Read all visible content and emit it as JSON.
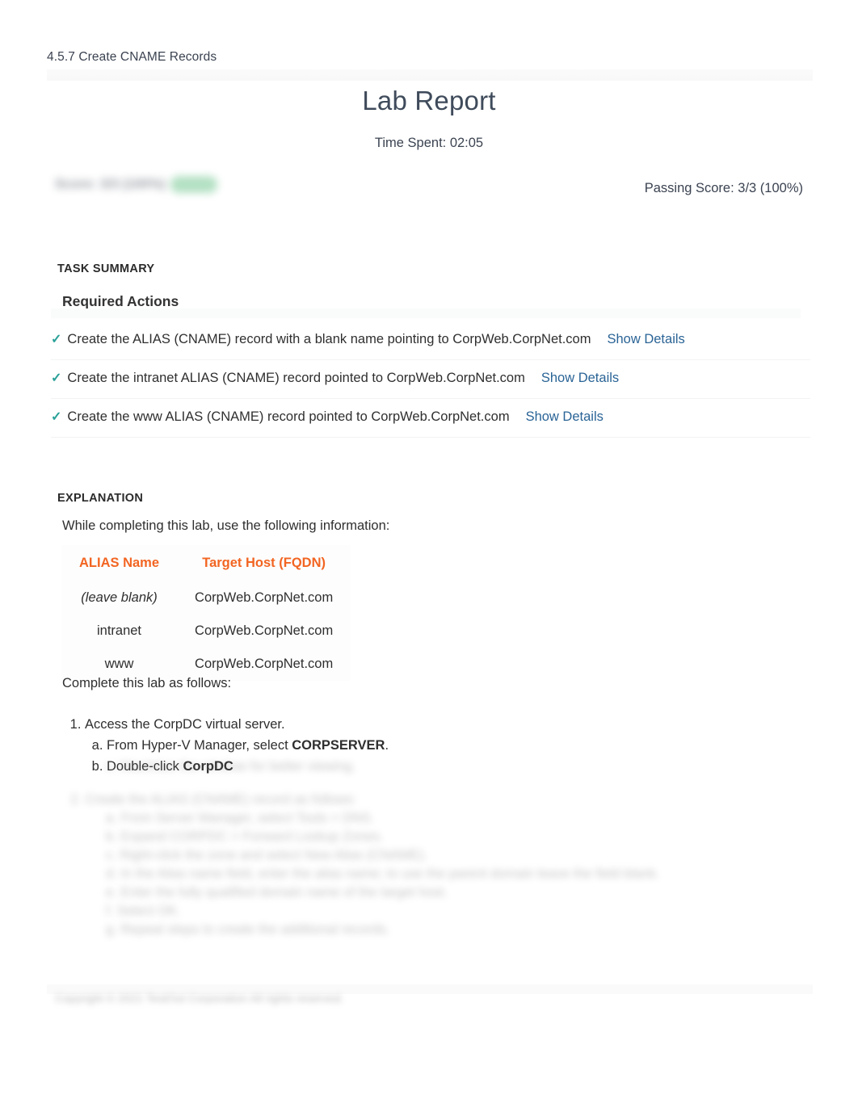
{
  "breadcrumb": "4.5.7 Create CNAME Records",
  "header": {
    "title": "Lab Report",
    "time_spent": "Time Spent: 02:05",
    "score_redacted": "Score: 3/3 (100%)",
    "score_badge": "Pass",
    "passing_score": "Passing Score: 3/3 (100%)"
  },
  "task_summary": {
    "section_label": "TASK SUMMARY",
    "subhead": "Required Actions",
    "items": [
      {
        "status_icon": "check-icon",
        "label": "Create the ALIAS (CNAME) record with a blank name pointing to CorpWeb.CorpNet.com",
        "link": "Show Details"
      },
      {
        "status_icon": "check-icon",
        "label": "Create the intranet ALIAS (CNAME) record pointed to CorpWeb.CorpNet.com",
        "link": "Show Details"
      },
      {
        "status_icon": "check-icon",
        "label": "Create the www ALIAS (CNAME) record pointed to CorpWeb.CorpNet.com",
        "link": "Show Details"
      }
    ]
  },
  "explanation": {
    "section_label": "EXPLANATION",
    "intro": "While completing this lab, use the following information:",
    "table": {
      "columns": [
        "ALIAS Name",
        "Target Host (FQDN)"
      ],
      "rows": [
        [
          "(leave blank)",
          "CorpWeb.CorpNet.com"
        ],
        [
          "intranet",
          "CorpWeb.CorpNet.com"
        ],
        [
          "www",
          "CorpWeb.CorpNet.com"
        ]
      ]
    },
    "complete_line": "Complete this lab as follows:",
    "steps": [
      {
        "text": "Access the CorpDC virtual server.",
        "substeps": [
          {
            "pre": "From Hyper-V Manager, select ",
            "bold": "CORPSERVER",
            "post": "."
          },
          {
            "pre": "Double-click ",
            "bold": "CorpDC",
            "post": ""
          }
        ]
      }
    ],
    "faded_steps": [
      "c. Maximize the window for better viewing.",
      "2. Create the ALIAS (CNAME) record as follows:",
      "a. From Server Manager, select Tools > DNS.",
      "b. Expand CORPDC > Forward Lookup Zones.",
      "c. Right-click the zone and select New Alias (CNAME).",
      "d. In the Alias name field, enter the alias name; to use the parent domain leave the field blank.",
      "e. Enter the fully qualified domain name of the target host.",
      "f. Select OK.",
      "g. Repeat steps to create the additional records."
    ]
  },
  "footer": {
    "copyright": "Copyright © 2021 TestOut Corporation All rights reserved."
  },
  "colors": {
    "check": "#2aa198",
    "link": "#2a6496",
    "table_header": "#f26522",
    "title": "#3f4b5b",
    "pass_badge": "#76c893"
  }
}
